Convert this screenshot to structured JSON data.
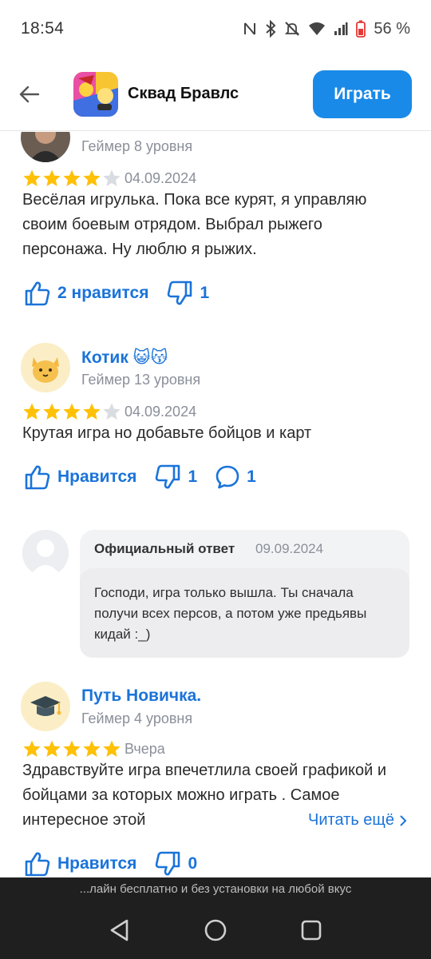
{
  "status_bar": {
    "time": "18:54",
    "battery": "56 %"
  },
  "header": {
    "app_name": "Сквад Бравлс",
    "play_label": "Играть"
  },
  "reviews": [
    {
      "level": "Геймер 8 уровня",
      "rating": 4,
      "date": "04.09.2024",
      "text": "Весёлая игрулька. Пока все курят, я управляю своим боевым отрядом. Выбрал рыжего персонажа. Ну люблю я рыжих.",
      "like_label": "2 нравится",
      "dislike_count": "1"
    },
    {
      "author": "Котик 😺😽",
      "level": "Геймер 13 уровня",
      "rating": 4,
      "date": "04.09.2024",
      "text": "Крутая игра но добавьте бойцов и карт",
      "like_label": "Нравится",
      "dislike_count": "1",
      "comment_count": "1"
    },
    {
      "author": "Путь Новичка.",
      "level": "Геймер 4 уровня",
      "rating": 5,
      "date": "Вчера",
      "text": "Здравствуйте игра впечетлила своей графикой и бойцами за которых можно играть . Самое интересное этой",
      "read_more": "Читать ещё",
      "like_label": "Нравится",
      "dislike_count": "0"
    }
  ],
  "official_reply": {
    "label": "Официальный ответ",
    "date": "09.09.2024",
    "text": "Господи, игра только вышла. Ты сначала получи всех персов, а потом уже предьявы кидай :_)"
  },
  "ticker": "...лайн бесплатно и без установки на любой вкус",
  "colors": {
    "accent": "#1a73d9",
    "play_button": "#1a8ae8",
    "star": "#ffc107",
    "star_empty": "#d9dce1"
  }
}
